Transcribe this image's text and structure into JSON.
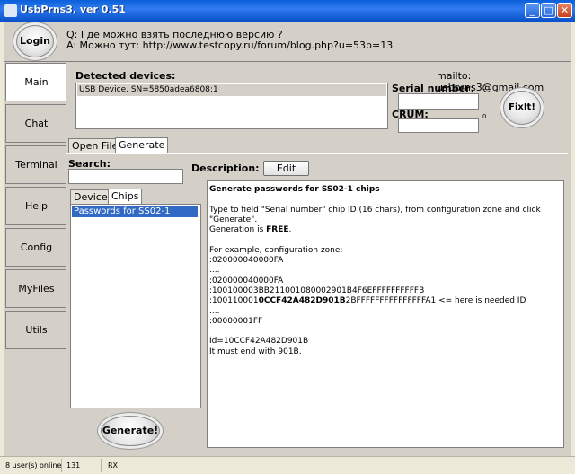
{
  "window": {
    "title": "UsbPrns3, ver 0.51",
    "minimize": "_",
    "maximize": "□",
    "close": "✕"
  },
  "header": {
    "login_label": "Login",
    "question": "Q: Где можно взять последнюю версию ?",
    "answer": "A: Можно тут: http://www.testcopy.ru/forum/blog.php?u=53b=13"
  },
  "nav": [
    "Main",
    "Chat",
    "Terminal",
    "Help",
    "Config",
    "MyFiles",
    "Utils"
  ],
  "main": {
    "detected_label": "Detected devices:",
    "devices": [
      "USB Device, SN=5850adea6808:1"
    ],
    "mailto": "mailto: usbprns3@gmail.com",
    "serial_label": "Serial number:",
    "serial_value": "",
    "serial_count": "0",
    "crum_label": "CRUM:",
    "crum_value": "",
    "crum_count": "0",
    "fixit_label": "FixIt!"
  },
  "tabs": [
    "Open File",
    "Generate"
  ],
  "generate": {
    "search_label": "Search:",
    "search_value": "",
    "description_label": "Description:",
    "edit_label": "Edit",
    "subtabs": [
      "Devices",
      "Chips"
    ],
    "chips": [
      "Passwords for SS02-1"
    ],
    "generate_label": "Generate!"
  },
  "description": {
    "title": "Generate passwords for SS02-1 chips",
    "p1": "Type to field \"Serial number\" chip ID (16 chars), from configuration zone and click \"Generate\".",
    "p2_prefix": "Generation is ",
    "p2_bold": "FREE",
    "p2_suffix": ".",
    "ex_header": "For example, configuration zone:",
    "l1": ":020000040000FA",
    "l2": "....",
    "l3": ":020000040000FA",
    "l4": ":100100003BB211001080002901B4F6EFFFFFFFFFFB",
    "l5_pre": ":100110001",
    "l5_bold": "0CCF42A482D901B",
    "l5_post": "2BFFFFFFFFFFFFFFFA1 <= here is needed ID",
    "l6": "....",
    "l7": ":00000001FF",
    "id_line": "Id=10CCF42A482D901B",
    "end_line": "It must end with 901B."
  },
  "status": {
    "users": "8 user(s) online",
    "count": "131",
    "rx": "RX"
  }
}
